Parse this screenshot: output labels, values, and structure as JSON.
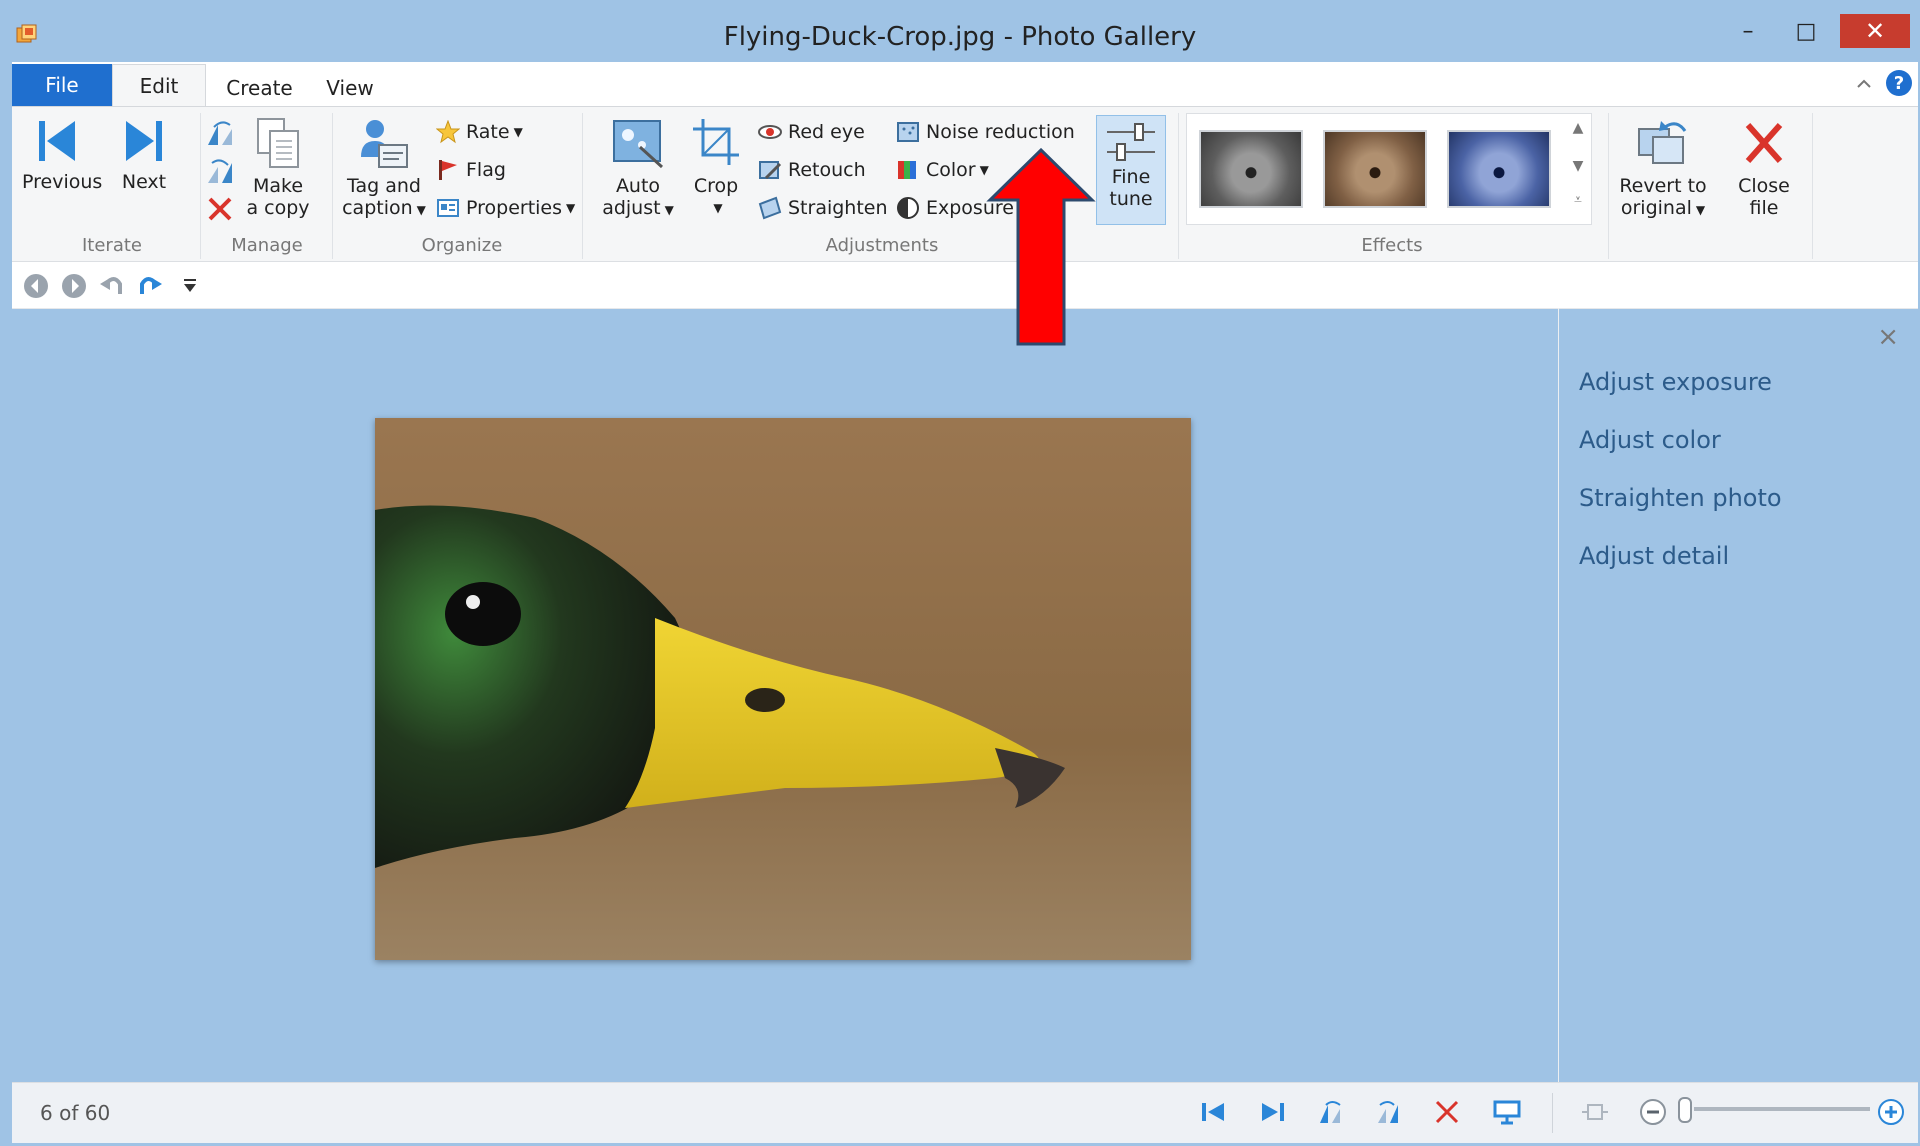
{
  "window": {
    "title": "Flying-Duck-Crop.jpg - Photo Gallery",
    "minimize_glyph": "–",
    "maximize_glyph": "□",
    "close_glyph": "✕"
  },
  "tabs": {
    "file": "File",
    "edit": "Edit",
    "create": "Create",
    "view": "View",
    "help_glyph": "?"
  },
  "ribbon": {
    "iterate": {
      "label": "Iterate",
      "previous": "Previous",
      "next": "Next"
    },
    "manage": {
      "label": "Manage",
      "make_copy_line1": "Make",
      "make_copy_line2": "a copy"
    },
    "organize": {
      "label": "Organize",
      "tag_line1": "Tag and",
      "tag_line2": "caption",
      "rate": "Rate",
      "flag": "Flag",
      "properties": "Properties"
    },
    "adjustments": {
      "label": "Adjustments",
      "auto_line1": "Auto",
      "auto_line2": "adjust",
      "crop": "Crop",
      "red_eye": "Red eye",
      "retouch": "Retouch",
      "straighten": "Straighten",
      "noise_reduction": "Noise reduction",
      "color": "Color",
      "exposure": "Exposure",
      "fine_line1": "Fine",
      "fine_line2": "tune"
    },
    "effects": {
      "label": "Effects"
    },
    "revert": {
      "line1": "Revert to",
      "line2": "original"
    },
    "close_file": {
      "line1": "Close",
      "line2": "file"
    }
  },
  "panel": {
    "links": [
      "Adjust exposure",
      "Adjust color",
      "Straighten photo",
      "Adjust detail"
    ],
    "close_glyph": "×"
  },
  "status": {
    "count": "6 of 60"
  },
  "colors": {
    "accent": "#1f6fcf",
    "frame": "#9fc3e5",
    "arrow": "#ff0000",
    "close": "#c73c2e"
  }
}
